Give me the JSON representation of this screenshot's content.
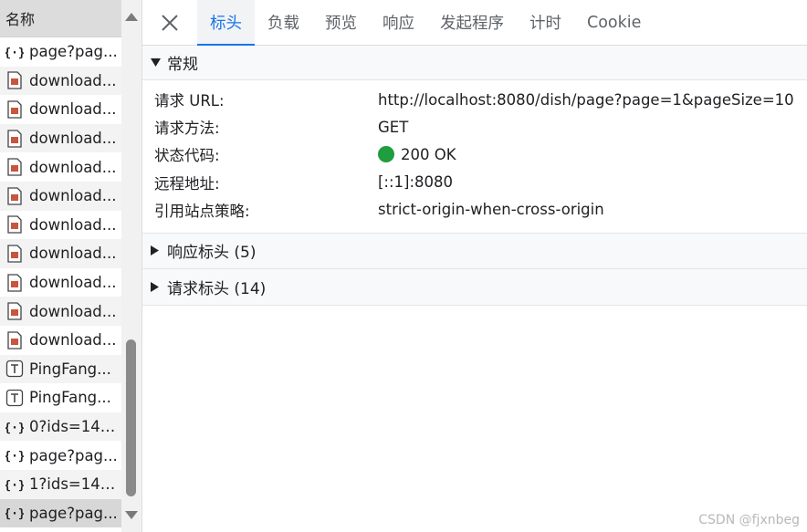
{
  "request_list": {
    "header": "名称",
    "items": [
      {
        "name": "page?pag...",
        "icon": "json-icon"
      },
      {
        "name": "download...",
        "icon": "image-file-icon"
      },
      {
        "name": "download...",
        "icon": "image-file-icon"
      },
      {
        "name": "download...",
        "icon": "image-file-icon"
      },
      {
        "name": "download...",
        "icon": "image-file-icon"
      },
      {
        "name": "download...",
        "icon": "image-file-icon"
      },
      {
        "name": "download...",
        "icon": "image-file-icon"
      },
      {
        "name": "download...",
        "icon": "image-file-icon"
      },
      {
        "name": "download...",
        "icon": "image-file-icon"
      },
      {
        "name": "download...",
        "icon": "image-file-icon"
      },
      {
        "name": "download...",
        "icon": "image-file-icon"
      },
      {
        "name": "PingFang...",
        "icon": "font-file-icon"
      },
      {
        "name": "PingFang...",
        "icon": "font-file-icon"
      },
      {
        "name": "0?ids=141...",
        "icon": "json-icon"
      },
      {
        "name": "page?pag...",
        "icon": "json-icon"
      },
      {
        "name": "1?ids=141...",
        "icon": "json-icon"
      },
      {
        "name": "page?pag...",
        "icon": "json-icon",
        "selected": true
      }
    ]
  },
  "tabs": [
    "标头",
    "负载",
    "预览",
    "响应",
    "发起程序",
    "计时",
    "Cookie"
  ],
  "active_tab": "标头",
  "general": {
    "title": "常规",
    "rows": [
      {
        "key": "请求 URL:",
        "value": "http://localhost:8080/dish/page?page=1&pageSize=10"
      },
      {
        "key": "请求方法:",
        "value": "GET"
      },
      {
        "key": "状态代码:",
        "value": "200 OK"
      },
      {
        "key": "远程地址:",
        "value": "[::1]:8080"
      },
      {
        "key": "引用站点策略:",
        "value": "strict-origin-when-cross-origin"
      }
    ]
  },
  "response_headers": "响应标头 (5)",
  "request_headers": "请求标头 (14)",
  "watermark": "CSDN @fjxnbeg",
  "colors": {
    "accent": "#1a73e8",
    "status_ok": "#1e9e3e"
  }
}
